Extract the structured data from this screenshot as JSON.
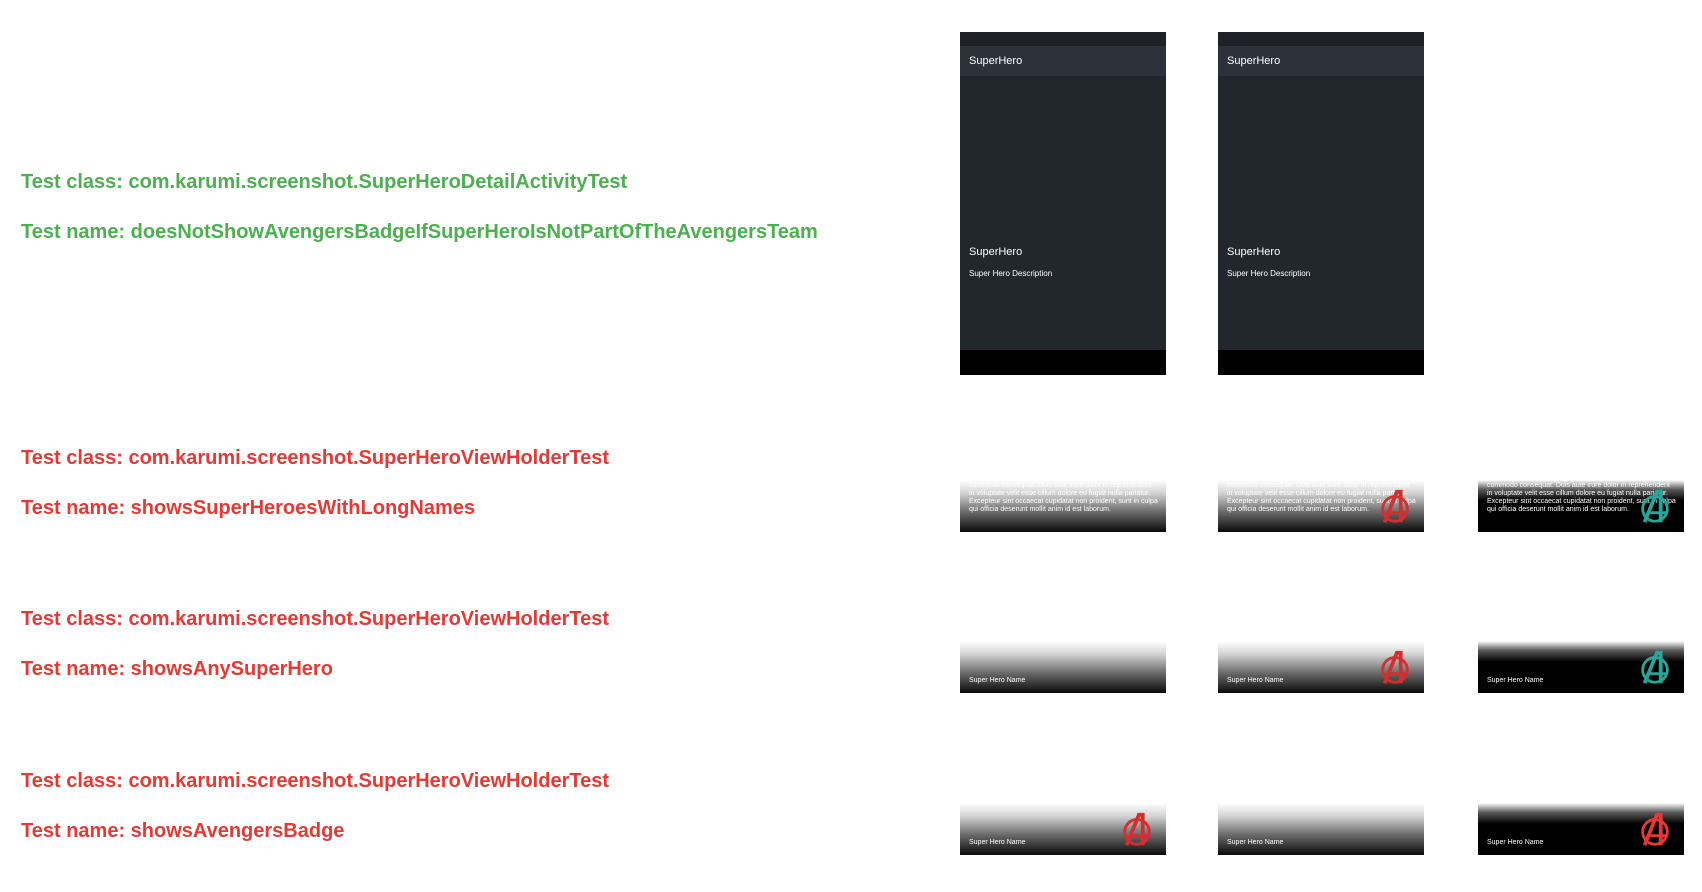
{
  "tests": [
    {
      "status": "pass",
      "class_label": "Test class: com.karumi.screenshot.SuperHeroDetailActivityTest",
      "name_label": "Test name: doesNotShowAvengersBadgeIfSuperHeroIsNotPartOfTheAvengersTeam"
    },
    {
      "status": "fail",
      "class_label": "Test class: com.karumi.screenshot.SuperHeroViewHolderTest",
      "name_label": "Test name: showsSuperHeroesWithLongNames"
    },
    {
      "status": "fail",
      "class_label": "Test class: com.karumi.screenshot.SuperHeroViewHolderTest",
      "name_label": "Test name: showsAnySuperHero"
    },
    {
      "status": "fail",
      "class_label": "Test class: com.karumi.screenshot.SuperHeroViewHolderTest",
      "name_label": "Test name: showsAvengersBadge"
    }
  ],
  "detail_shots": {
    "expected": {
      "app_title": "SuperHero",
      "hero_name": "SuperHero",
      "hero_description": "Super Hero Description"
    },
    "recorded": {
      "app_title": "SuperHero",
      "hero_name": "SuperHero",
      "hero_description": "Super Hero Description"
    }
  },
  "long_name_text": "commodo consequat. Duis aute irure dolor in reprehenderit in voluptate velit esse cillum dolore eu fugiat nulla pariatur. Excepteur sint occaecat cupidatat non proident, sunt in culpa qui officia deserunt mollit anim id est laborum.",
  "row_name": "Super Hero Name",
  "colors": {
    "pass": "#4caf50",
    "fail": "#e53935",
    "badge_red": "#d32f2f",
    "badge_teal": "#26a69a",
    "phone_bg": "#22272e"
  },
  "icons": {
    "badge": "avengers-badge-icon",
    "diff_badge": "avengers-badge-diff-icon"
  }
}
